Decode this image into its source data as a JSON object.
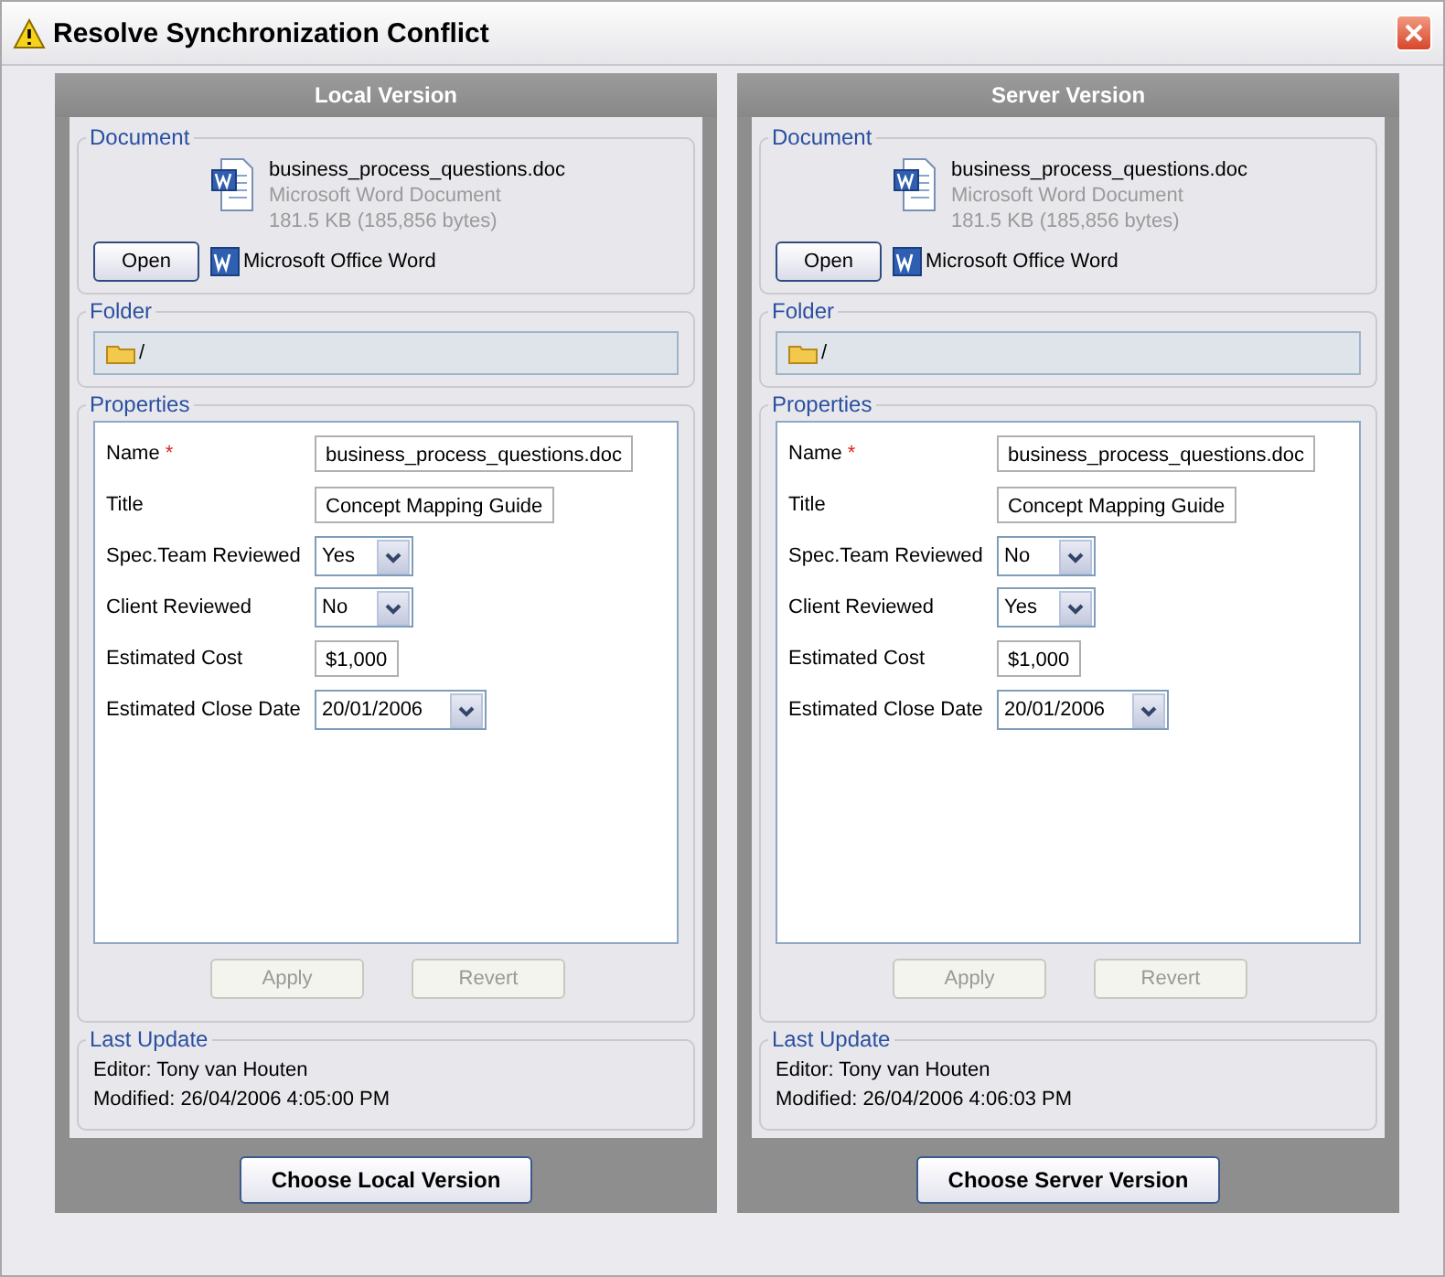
{
  "window": {
    "title": "Resolve Synchronization Conflict"
  },
  "panels": [
    {
      "heading": "Local Version",
      "document": {
        "label": "Document",
        "filename": "business_process_questions.doc",
        "type": "Microsoft Word Document",
        "size": "181.5 KB (185,856 bytes)",
        "open_button": "Open",
        "app": "Microsoft Office Word"
      },
      "folder": {
        "label": "Folder",
        "path": "/"
      },
      "properties": {
        "label": "Properties",
        "fields": [
          {
            "label": "Name",
            "marker": "*",
            "kind": "text",
            "value": "business_process_questions.doc"
          },
          {
            "label": "Title",
            "kind": "text",
            "value": "Concept Mapping Guide"
          },
          {
            "label": "Spec.Team Reviewed",
            "kind": "dropdown",
            "value": "Yes"
          },
          {
            "label": "Client Reviewed",
            "kind": "dropdown",
            "value": "No"
          },
          {
            "label": "Estimated Cost",
            "kind": "text",
            "value": "$1,000"
          },
          {
            "label": "Estimated Close Date",
            "kind": "dropdown",
            "value": "20/01/2006"
          }
        ],
        "buttons": [
          {
            "label": "Apply",
            "disabled": true
          },
          {
            "label": "Revert",
            "disabled": true
          }
        ]
      },
      "last_update": {
        "label": "Last Update",
        "editor": "Editor: Tony van Houten",
        "modified": "Modified: 26/04/2006 4:05:00 PM"
      },
      "choose_button": "Choose Local Version"
    },
    {
      "heading": "Server Version",
      "document": {
        "label": "Document",
        "filename": "business_process_questions.doc",
        "type": "Microsoft Word Document",
        "size": "181.5 KB (185,856 bytes)",
        "open_button": "Open",
        "app": "Microsoft Office Word"
      },
      "folder": {
        "label": "Folder",
        "path": "/"
      },
      "properties": {
        "label": "Properties",
        "fields": [
          {
            "label": "Name",
            "marker": "*",
            "kind": "text",
            "value": "business_process_questions.doc"
          },
          {
            "label": "Title",
            "kind": "text",
            "value": "Concept Mapping Guide"
          },
          {
            "label": "Spec.Team Reviewed",
            "kind": "dropdown",
            "value": "No"
          },
          {
            "label": "Client Reviewed",
            "kind": "dropdown",
            "value": "Yes"
          },
          {
            "label": "Estimated Cost",
            "kind": "text",
            "value": "$1,000"
          },
          {
            "label": "Estimated Close Date",
            "kind": "dropdown",
            "value": "20/01/2006"
          }
        ],
        "buttons": [
          {
            "label": "Apply",
            "disabled": true
          },
          {
            "label": "Revert",
            "disabled": true
          }
        ]
      },
      "last_update": {
        "label": "Last Update",
        "editor": "Editor: Tony van Houten",
        "modified": "Modified: 26/04/2006 4:06:03 PM"
      },
      "choose_button": "Choose Server Version"
    }
  ]
}
